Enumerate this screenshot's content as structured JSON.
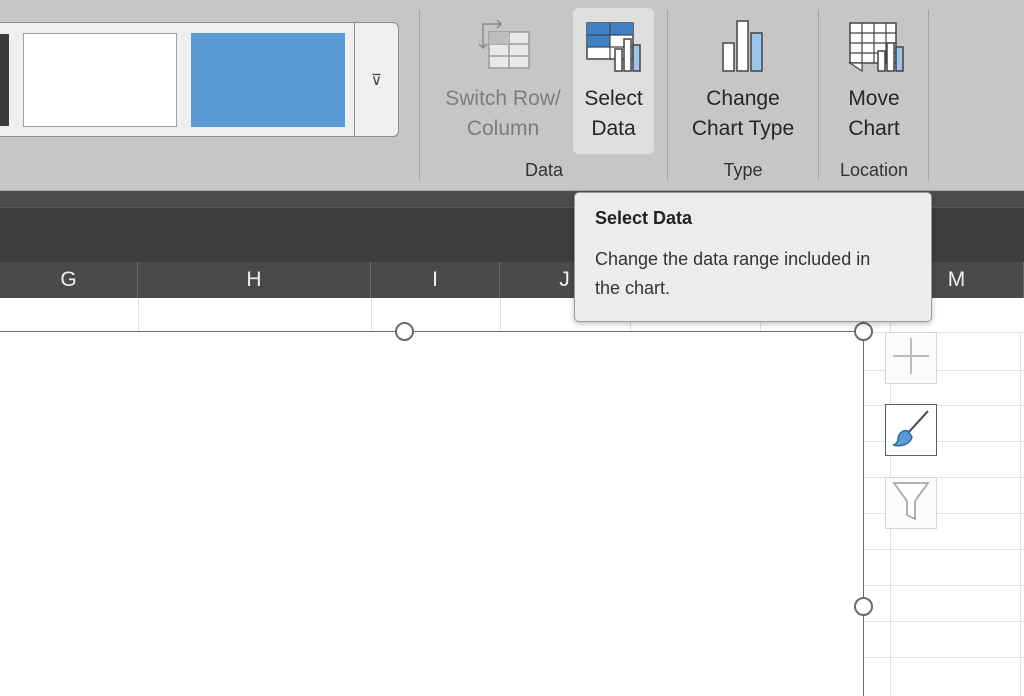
{
  "ribbon": {
    "gallery_more_glyph": "⊽",
    "buttons": {
      "switch_row_column": {
        "line1": "Switch Row/",
        "line2": "Column",
        "icon": "switch-row-column-icon",
        "enabled": false
      },
      "select_data": {
        "line1": "Select",
        "line2": "Data",
        "icon": "select-data-icon",
        "hovered": true
      },
      "change_chart_type": {
        "line1": "Change",
        "line2": "Chart Type",
        "icon": "change-chart-type-icon"
      },
      "move_chart": {
        "line1": "Move",
        "line2": "Chart",
        "icon": "move-chart-icon"
      }
    },
    "groups": {
      "data": "Data",
      "type": "Type",
      "location": "Location"
    }
  },
  "sheet": {
    "columns": [
      "G",
      "H",
      "I",
      "J",
      "M"
    ]
  },
  "chart_tools": {
    "elements": "add-chart-element-icon",
    "styles": "chart-styles-brush-icon",
    "filters": "chart-filters-funnel-icon"
  },
  "tooltip": {
    "title": "Select Data",
    "body_line1": "Change the data range included in",
    "body_line2": "the chart."
  },
  "colors": {
    "ribbon_bg": "#c6c6c6",
    "accent_blue": "#5b9bd5",
    "dark_header": "#4a4a4a"
  }
}
